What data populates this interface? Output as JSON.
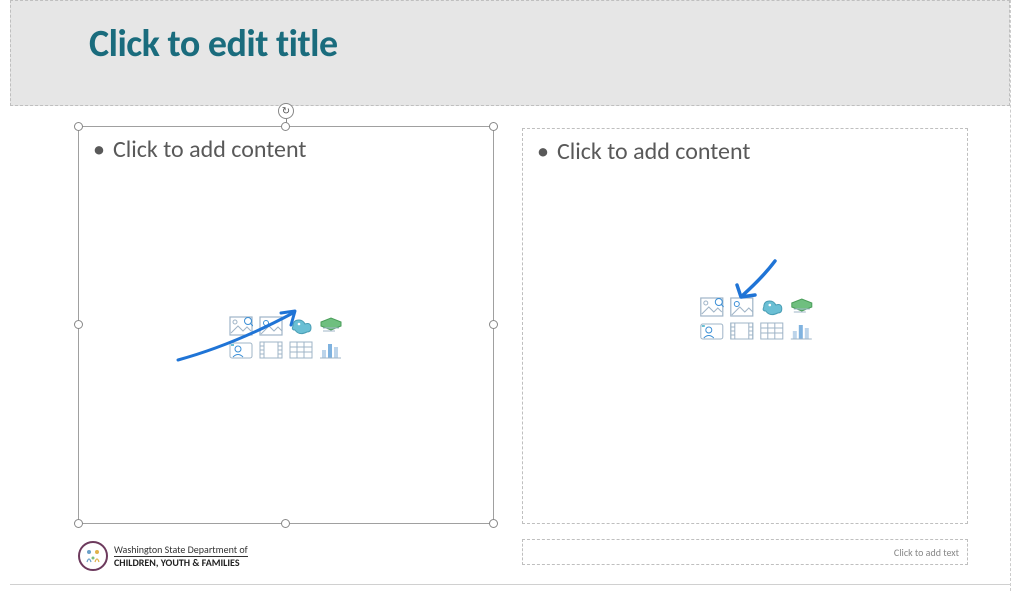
{
  "title": {
    "placeholder": "Click to edit title"
  },
  "content_left": {
    "bullet": "Click to add content"
  },
  "content_right": {
    "bullet": "Click to add content"
  },
  "notes": {
    "placeholder": "Click to add text"
  },
  "footer": {
    "line1": "Washington State Department of",
    "line2": "CHILDREN, YOUTH & FAMILIES"
  },
  "icons": {
    "row1": [
      "stock-image-icon",
      "insert-picture-icon",
      "icons-icon",
      "smartart-icon"
    ],
    "row2": [
      "cameo-icon",
      "insert-video-icon",
      "insert-table-icon",
      "insert-chart-icon"
    ]
  },
  "colors": {
    "title": "#1a6c7d",
    "ink": "#1f74d6"
  }
}
